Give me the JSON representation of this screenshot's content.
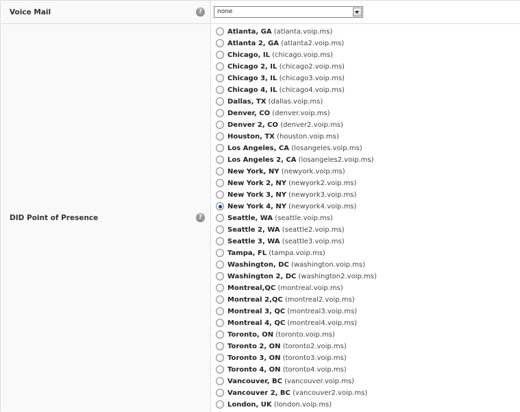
{
  "voice_mail": {
    "label": "Voice Mail",
    "help_icon": "question-mark",
    "select_value": "none"
  },
  "did_pop": {
    "label": "DID Point of Presence",
    "help_icon": "question-mark",
    "selected_index": 15,
    "options": [
      {
        "city": "Atlanta, GA",
        "host": "(atlanta.voip.ms)"
      },
      {
        "city": "Atlanta 2, GA",
        "host": "(atlanta2.voip.ms)"
      },
      {
        "city": "Chicago, IL",
        "host": "(chicago.voip.ms)"
      },
      {
        "city": "Chicago 2, IL",
        "host": "(chicago2.voip.ms)"
      },
      {
        "city": "Chicago 3, IL",
        "host": "(chicago3.voip.ms)"
      },
      {
        "city": "Chicago 4, IL",
        "host": "(chicago4.voip.ms)"
      },
      {
        "city": "Dallas, TX",
        "host": "(dallas.voip.ms)"
      },
      {
        "city": "Denver, CO",
        "host": "(denver.voip.ms)"
      },
      {
        "city": "Denver 2, CO",
        "host": "(denver2.voip.ms)"
      },
      {
        "city": "Houston, TX",
        "host": "(houston.voip.ms)"
      },
      {
        "city": "Los Angeles, CA",
        "host": "(losangeles.voip.ms)"
      },
      {
        "city": "Los Angeles 2, CA",
        "host": "(losangeles2.voip.ms)"
      },
      {
        "city": "New York, NY",
        "host": "(newyork.voip.ms)"
      },
      {
        "city": "New York 2, NY",
        "host": "(newyork2.voip.ms)"
      },
      {
        "city": "New York 3, NY",
        "host": "(newyork3.voip.ms)"
      },
      {
        "city": "New York 4, NY",
        "host": "(newyork4.voip.ms)"
      },
      {
        "city": "Seattle, WA",
        "host": "(seattle.voip.ms)"
      },
      {
        "city": "Seattle 2, WA",
        "host": "(seattle2.voip.ms)"
      },
      {
        "city": "Seattle 3, WA",
        "host": "(seattle3.voip.ms)"
      },
      {
        "city": "Tampa, FL",
        "host": "(tampa.voip.ms)"
      },
      {
        "city": "Washington, DC",
        "host": "(washington.voip.ms)"
      },
      {
        "city": "Washington 2, DC",
        "host": "(washington2.voip.ms)"
      },
      {
        "city": "Montreal,QC",
        "host": "(montreal.voip.ms)"
      },
      {
        "city": "Montreal 2,QC",
        "host": "(montreal2.voip.ms)"
      },
      {
        "city": "Montreal 3, QC",
        "host": "(montreal3.voip.ms)"
      },
      {
        "city": "Montreal 4, QC",
        "host": "(montreal4.voip.ms)"
      },
      {
        "city": "Toronto, ON",
        "host": "(toronto.voip.ms)"
      },
      {
        "city": "Toronto 2, ON",
        "host": "(toronto2.voip.ms)"
      },
      {
        "city": "Toronto 3, ON",
        "host": "(toronto3.voip.ms)"
      },
      {
        "city": "Toronto 4, ON",
        "host": "(toronto4.voip.ms)"
      },
      {
        "city": "Vancouver, BC",
        "host": "(vancouver.voip.ms)"
      },
      {
        "city": "Vancouver 2, BC",
        "host": "(vancouver2.voip.ms)"
      },
      {
        "city": "London, UK",
        "host": "(london.voip.ms)"
      }
    ]
  }
}
